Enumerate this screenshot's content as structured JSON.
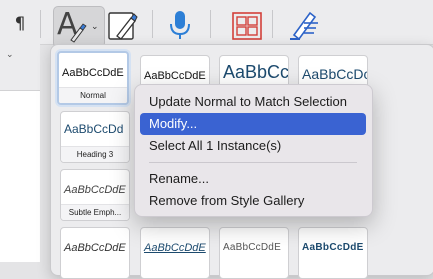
{
  "ribbon": {
    "paragraph_mark": "¶",
    "styles_glyph": "A",
    "icons": [
      "paragraph-mark-icon",
      "styles-icon",
      "styles-pane-icon",
      "microphone-icon",
      "design-grid-icon",
      "editor-pen-icon"
    ]
  },
  "gallery": {
    "rows": [
      [
        {
          "sample": "AaBbCcDdE",
          "label": "Normal",
          "selected": true
        },
        {
          "sample": "AaBbCcDdE",
          "label": ""
        },
        {
          "sample": "AaBbCc",
          "label": ""
        },
        {
          "sample": "AaBbCcDc",
          "label": ""
        }
      ],
      [
        {
          "sample": "AaBbCcDd",
          "label": "Heading 3"
        }
      ],
      [
        {
          "sample": "AaBbCcDdE",
          "label": "Subtle Emph..."
        }
      ],
      [
        {
          "sample": "AaBbCcDdE",
          "label": ""
        },
        {
          "sample": "AaBbCcDdE",
          "label": ""
        },
        {
          "sample": "AaBbCcDdE",
          "label": ""
        },
        {
          "sample": "AaBbCcDdE",
          "label": ""
        }
      ]
    ]
  },
  "context_menu": {
    "items": [
      {
        "label": "Update Normal to Match Selection"
      },
      {
        "label": "Modify...",
        "highlighted": true
      },
      {
        "label": "Select All 1 Instance(s)"
      },
      {
        "label": "Rename..."
      },
      {
        "label": "Remove from Style Gallery"
      }
    ],
    "highlight_color": "#3a63d2"
  }
}
